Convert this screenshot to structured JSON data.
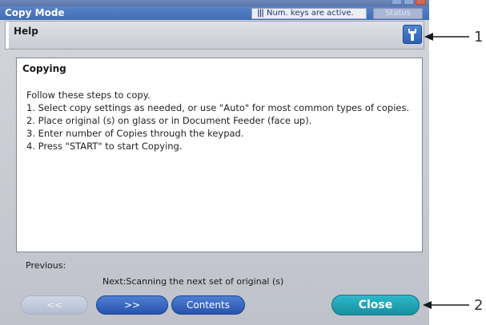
{
  "window": {
    "title": "Copy Mode",
    "num_keys_status": "Num. keys are active.",
    "status_button_label": "Status"
  },
  "help": {
    "title": "Help",
    "tool_icon": "wrench-icon"
  },
  "content": {
    "heading": "Copying",
    "lines": [
      "Follow these steps to copy.",
      "1. Select copy settings as needed, or use \"Auto\" for most common types of copies.",
      "2. Place original (s) on glass or in Document Feeder (face up).",
      "3. Enter number of Copies through the keypad.",
      "4. Press \"START\" to start Copying."
    ]
  },
  "navigation": {
    "previous_label": "Previous:",
    "next_label": "Next:Scanning the next set of original (s)"
  },
  "buttons": {
    "back_label": "<<",
    "forward_label": ">>",
    "contents_label": "Contents",
    "close_label": "Close"
  },
  "callouts": {
    "one": "1",
    "two": "2"
  },
  "colors": {
    "titlebar": "#3f6db6",
    "primary_button": "#2753ad",
    "close_button": "#17919f",
    "disabled_button": "#b3bdd2"
  }
}
